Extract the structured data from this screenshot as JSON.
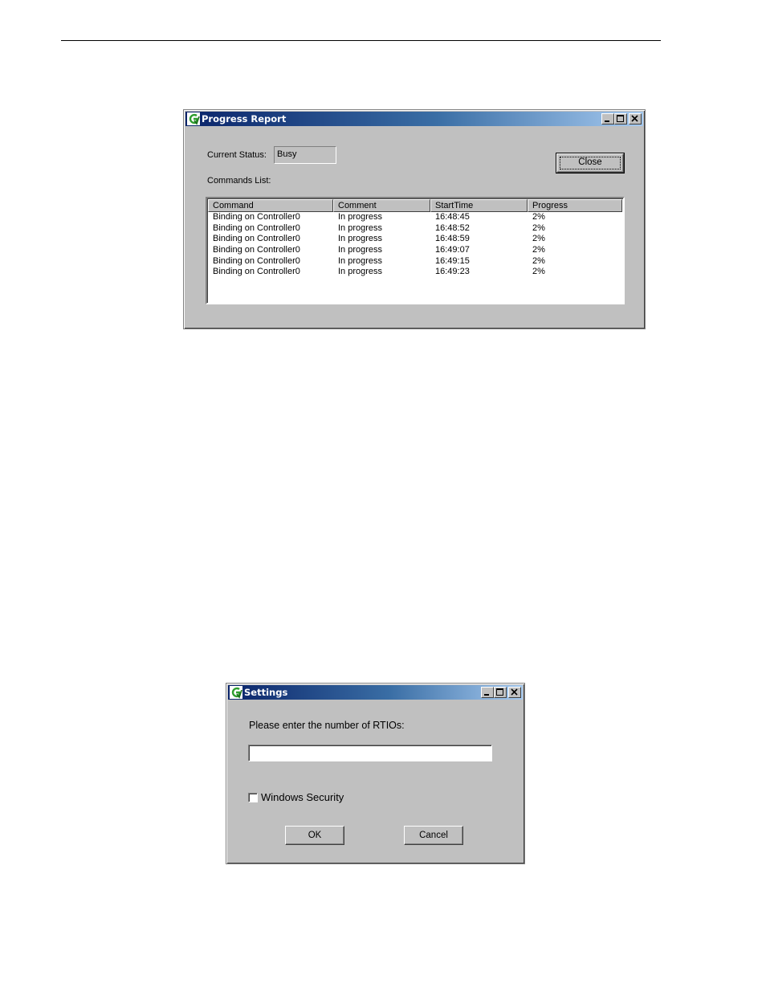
{
  "progress_report": {
    "title": "Progress Report",
    "current_status_label": "Current Status:",
    "current_status_value": "Busy",
    "commands_list_label": "Commands List:",
    "close_label": "Close",
    "columns": [
      "Command",
      "Comment",
      "StartTime",
      "Progress"
    ],
    "rows": [
      {
        "command": "Binding on Controller0",
        "comment": "In progress",
        "start_time": "16:48:45",
        "progress": "2%"
      },
      {
        "command": "Binding on Controller0",
        "comment": "In progress",
        "start_time": "16:48:52",
        "progress": "2%"
      },
      {
        "command": "Binding on Controller0",
        "comment": "In progress",
        "start_time": "16:48:59",
        "progress": "2%"
      },
      {
        "command": "Binding on Controller0",
        "comment": "In progress",
        "start_time": "16:49:07",
        "progress": "2%"
      },
      {
        "command": "Binding on Controller0",
        "comment": "In progress",
        "start_time": "16:49:15",
        "progress": "2%"
      },
      {
        "command": "Binding on Controller0",
        "comment": "In progress",
        "start_time": "16:49:23",
        "progress": "2%"
      }
    ]
  },
  "settings": {
    "title": "Settings",
    "prompt": "Please enter the number of RTIOs:",
    "input_value": "",
    "checkbox_label": "Windows Security",
    "checkbox_checked": false,
    "ok_label": "OK",
    "cancel_label": "Cancel"
  },
  "icons": {
    "app": "grass-valley-g-icon",
    "minimize": "minimize-icon",
    "maximize": "maximize-icon",
    "close": "close-icon"
  },
  "colors": {
    "titlebar_start": "#0a246a",
    "titlebar_end": "#a6caf0",
    "face": "#c0c0c0"
  }
}
